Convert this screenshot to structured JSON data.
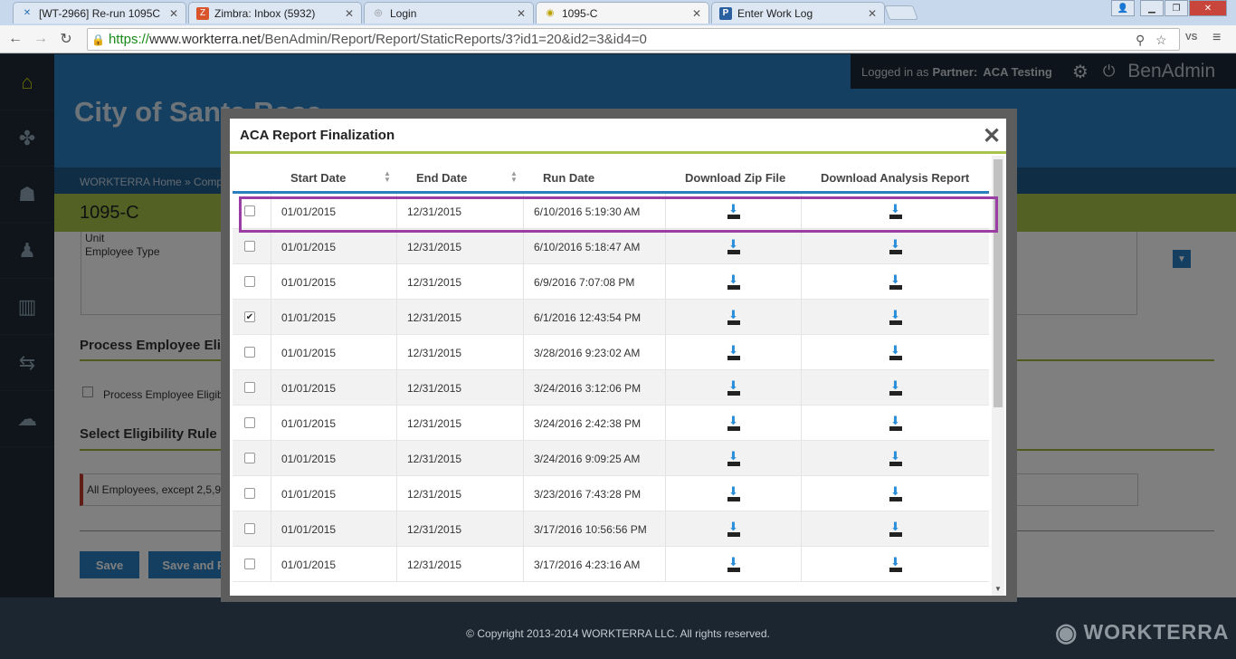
{
  "browser": {
    "tabs": [
      {
        "label": "[WT-2966] Re-run 1095C",
        "icon": "jira-icon"
      },
      {
        "label": "Zimbra: Inbox (5932)",
        "icon": "zimbra-icon"
      },
      {
        "label": "Login",
        "icon": "globe-icon"
      },
      {
        "label": "1095-C",
        "icon": "workterra-icon"
      },
      {
        "label": "Enter Work Log",
        "icon": "p-icon"
      }
    ],
    "url_secure": "https://",
    "url_host": "www.workterra.net",
    "url_path": "/BenAdmin/Report/Report/StaticReports/3?id1=20&id2=3&id4=0"
  },
  "app": {
    "company": "City of Santa Rosa",
    "logged_in_prefix": "Logged in as",
    "partner_label": "Partner:",
    "partner_name": "ACA Testing",
    "app_name": "BenAdmin",
    "breadcrumb": "WORKTERRA Home »  Compan",
    "page_title": "1095-C",
    "fields": {
      "unit": "Unit",
      "employee_type": "Employee Type",
      "process_section": "Process Employee Eligibi",
      "process_checkbox": "Process Employee Eligibili",
      "rule_section": "Select Eligibility Rule",
      "rule_value": "All Employees, except 2,5,9"
    },
    "buttons": {
      "save": "Save",
      "save_and": "Save and P"
    },
    "footer_copyright": "© Copyright 2013-2014 WORKTERRA LLC. All rights reserved.",
    "footer_brand": "WORKTERRA"
  },
  "modal": {
    "title": "ACA Report Finalization",
    "columns": [
      "Start Date",
      "End Date",
      "Run Date",
      "Download Zip File",
      "Download Analysis Report"
    ],
    "rows": [
      {
        "start": "01/01/2015",
        "end": "12/31/2015",
        "run": "6/10/2016 5:19:30 AM",
        "checked": false
      },
      {
        "start": "01/01/2015",
        "end": "12/31/2015",
        "run": "6/10/2016 5:18:47 AM",
        "checked": false
      },
      {
        "start": "01/01/2015",
        "end": "12/31/2015",
        "run": "6/9/2016 7:07:08 PM",
        "checked": false
      },
      {
        "start": "01/01/2015",
        "end": "12/31/2015",
        "run": "6/1/2016 12:43:54 PM",
        "checked": true
      },
      {
        "start": "01/01/2015",
        "end": "12/31/2015",
        "run": "3/28/2016 9:23:02 AM",
        "checked": false
      },
      {
        "start": "01/01/2015",
        "end": "12/31/2015",
        "run": "3/24/2016 3:12:06 PM",
        "checked": false
      },
      {
        "start": "01/01/2015",
        "end": "12/31/2015",
        "run": "3/24/2016 2:42:38 PM",
        "checked": false
      },
      {
        "start": "01/01/2015",
        "end": "12/31/2015",
        "run": "3/24/2016 9:09:25 AM",
        "checked": false
      },
      {
        "start": "01/01/2015",
        "end": "12/31/2015",
        "run": "3/23/2016 7:43:28 PM",
        "checked": false
      },
      {
        "start": "01/01/2015",
        "end": "12/31/2015",
        "run": "3/17/2016 10:56:56 PM",
        "checked": false
      },
      {
        "start": "01/01/2015",
        "end": "12/31/2015",
        "run": "3/17/2016 4:23:16 AM",
        "checked": false
      }
    ],
    "highlight_color": "#9b3ea3"
  }
}
